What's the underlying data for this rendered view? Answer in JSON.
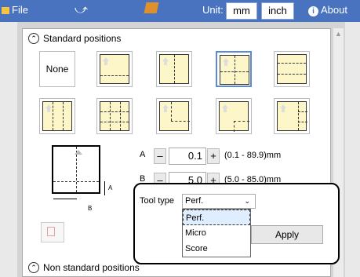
{
  "topbar": {
    "file": "File",
    "unit_label": "Unit:",
    "unit_mm": "mm",
    "unit_inch": "inch",
    "about": "About",
    "about_icon": "info-icon"
  },
  "standard": {
    "title": "Standard positions",
    "none_label": "None"
  },
  "measure": {
    "a_label": "A",
    "a_value": "0.1",
    "a_range": "(0.1 - 89.9)mm",
    "b_label": "B",
    "b_value": "5.0",
    "b_range": "(5.0 - 85.0)mm",
    "minus": "–",
    "plus": "+",
    "diagram_a": "A",
    "diagram_b": "B"
  },
  "tooltype": {
    "label": "Tool type",
    "selected": "Perf.",
    "options": [
      "Perf.",
      "Micro",
      "Score"
    ],
    "apply": "Apply"
  },
  "nonstandard": {
    "title": "Non standard positions"
  }
}
